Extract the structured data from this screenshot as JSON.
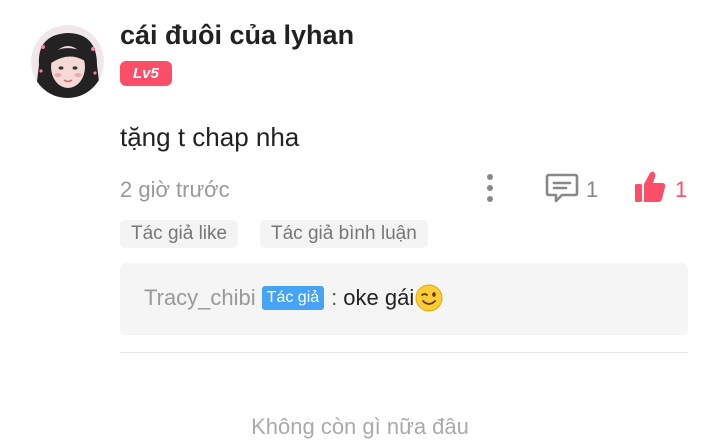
{
  "comment": {
    "username": "cái đuôi của lyhan",
    "level": "Lv5",
    "text": "tặng t chap nha",
    "timestamp": "2 giờ trước",
    "reply_count": "1",
    "like_count": "1",
    "tags": [
      "Tác giả like",
      "Tác giả bình luận"
    ]
  },
  "reply": {
    "username": "Tracy_chibi",
    "badge": "Tác giả",
    "separator": ":",
    "text": "oke gái",
    "emoji": "winking-face"
  },
  "footer": {
    "text": "Không còn gì nữa đâu"
  },
  "colors": {
    "accent": "#fc4f67",
    "author_badge": "#46a3f5",
    "muted_text": "#999999"
  },
  "icons": [
    "more-vertical-icon",
    "comment-icon",
    "thumbs-up-icon"
  ]
}
